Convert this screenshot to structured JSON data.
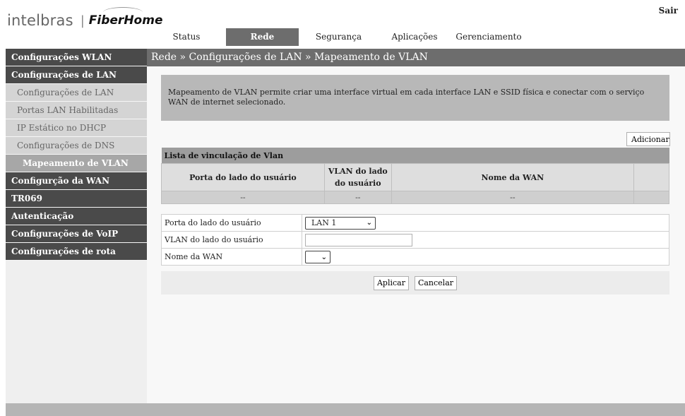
{
  "header": {
    "logo_left": "intelbras",
    "logo_separator": "|",
    "logo_right": "FiberHome",
    "logout_label": "Sair"
  },
  "tabs": [
    {
      "label": "Status",
      "active": false
    },
    {
      "label": "Rede",
      "active": true
    },
    {
      "label": "Segurança",
      "active": false
    },
    {
      "label": "Aplicações",
      "active": false
    },
    {
      "label": "Gerenciamento",
      "active": false
    }
  ],
  "sidebar": {
    "items": [
      {
        "label": "Configurações WLAN",
        "level": "main"
      },
      {
        "label": "Configurações de LAN",
        "level": "main"
      },
      {
        "label": "Configurações de LAN",
        "level": "sub"
      },
      {
        "label": "Portas LAN Habilitadas",
        "level": "sub"
      },
      {
        "label": "IP Estático no DHCP",
        "level": "sub"
      },
      {
        "label": "Configurações de DNS",
        "level": "sub"
      },
      {
        "label": "Mapeamento de VLAN",
        "level": "sub",
        "active": true
      },
      {
        "label": "Configurção da WAN",
        "level": "main"
      },
      {
        "label": "TR069",
        "level": "main"
      },
      {
        "label": "Autenticação",
        "level": "main"
      },
      {
        "label": "Configurações de VoIP",
        "level": "main"
      },
      {
        "label": "Configurações de rota",
        "level": "main"
      }
    ]
  },
  "main": {
    "breadcrumb": "Rede » Configurações de LAN » Mapeamento de VLAN",
    "info_text": "Mapeamento de VLAN permite criar uma interface virtual em cada interface LAN e SSID física e conectar com o serviço WAN de internet selecionado.",
    "add_button": "Adicionar",
    "table": {
      "title": "Lista de vinculação de Vlan",
      "headers": [
        "Porta do lado do usuário",
        "VLAN do lado do usuário",
        "Nome da WAN",
        ""
      ],
      "rows": [
        [
          "--",
          "--",
          "--",
          ""
        ]
      ]
    },
    "form": {
      "port_label": "Porta do lado do usuário",
      "port_value": "LAN 1",
      "vlan_label": "VLAN do lado do usuário",
      "vlan_value": "",
      "wan_label": "Nome da WAN",
      "wan_value": ""
    },
    "buttons": {
      "apply": "Aplicar",
      "cancel": "Cancelar"
    }
  },
  "colors": {
    "nav_active": "#6d6d6d",
    "sidebar_main": "#4a4a4a",
    "sidebar_sub": "#d4d4d4",
    "sidebar_sub_active": "#a7a7a7",
    "info_box": "#b8b8b8"
  }
}
